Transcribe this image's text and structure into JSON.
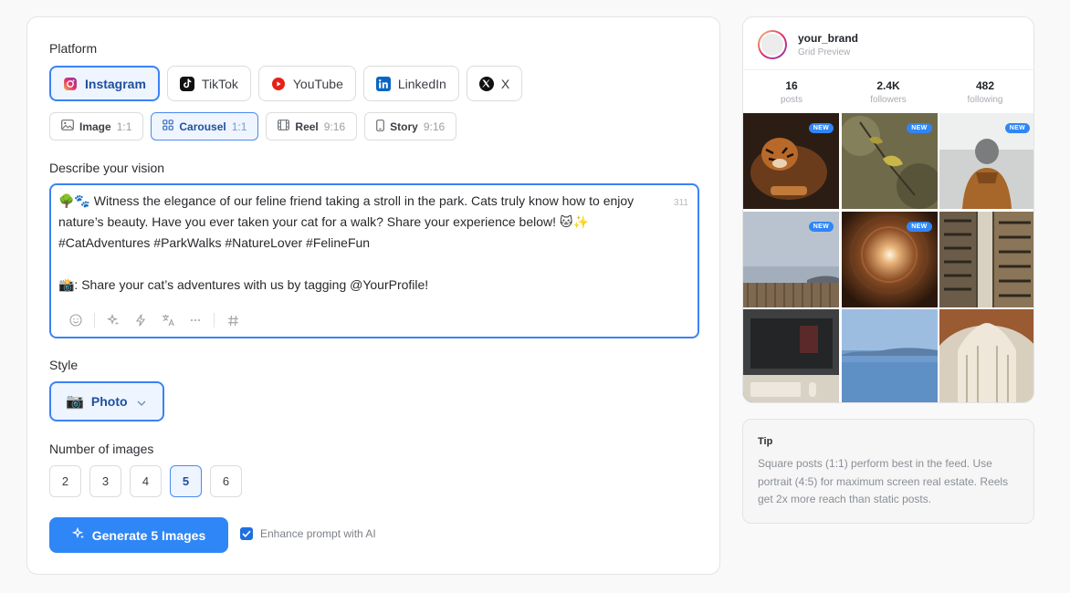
{
  "platform": {
    "label": "Platform",
    "options": [
      {
        "name": "Instagram",
        "active": true,
        "color": "#e1306c"
      },
      {
        "name": "TikTok",
        "active": false,
        "color": "#111111"
      },
      {
        "name": "YouTube",
        "active": false,
        "color": "#ff0000"
      },
      {
        "name": "LinkedIn",
        "active": false,
        "color": "#0a66c2"
      },
      {
        "name": "X",
        "active": false,
        "color": "#000000"
      }
    ]
  },
  "formats": [
    {
      "name": "Image",
      "ratio": "1:1",
      "icon": "image-icon",
      "active": false
    },
    {
      "name": "Carousel",
      "ratio": "1:1",
      "icon": "grid-icon",
      "active": true
    },
    {
      "name": "Reel",
      "ratio": "9:16",
      "icon": "film-icon",
      "active": false
    },
    {
      "name": "Story",
      "ratio": "9:16",
      "icon": "phone-icon",
      "active": false
    }
  ],
  "vision": {
    "label": "Describe your vision",
    "text": "🌳🐾 Witness the elegance of our feline friend taking a stroll in the park. Cats truly know how to enjoy nature’s beauty. Have you ever taken your cat for a walk? Share your experience below! 🐱✨ #CatAdventures #ParkWalks #NatureLover #FelineFun\n\n📸: Share your cat’s adventures with us by tagging @YourProfile!",
    "char_count": "311"
  },
  "style": {
    "label": "Style",
    "emoji": "📷",
    "value": "Photo"
  },
  "image_count": {
    "label": "Number of images",
    "options": [
      "2",
      "3",
      "4",
      "5",
      "6"
    ],
    "selected": "5"
  },
  "generate": {
    "label": "Generate 5 Images",
    "enhance_label": "Enhance prompt with AI",
    "enhance_checked": true
  },
  "preview": {
    "username": "your_brand",
    "subtitle": "Grid Preview",
    "stats": [
      {
        "value": "16",
        "label": "posts"
      },
      {
        "value": "2.4K",
        "label": "followers"
      },
      {
        "value": "482",
        "label": "following"
      }
    ],
    "badge_text": "NEW",
    "tiles": [
      {
        "new": true
      },
      {
        "new": true
      },
      {
        "new": true
      },
      {
        "new": true
      },
      {
        "new": true
      },
      {
        "new": false
      },
      {
        "new": false
      },
      {
        "new": false
      },
      {
        "new": false
      }
    ]
  },
  "tip": {
    "title": "Tip",
    "text": "Square posts (1:1) perform best in the feed. Use portrait (4:5) for maximum screen real estate. Reels get 2x more reach than static posts."
  },
  "colors": {
    "accent": "#3b82f6",
    "primary_button": "#2f86f6"
  }
}
